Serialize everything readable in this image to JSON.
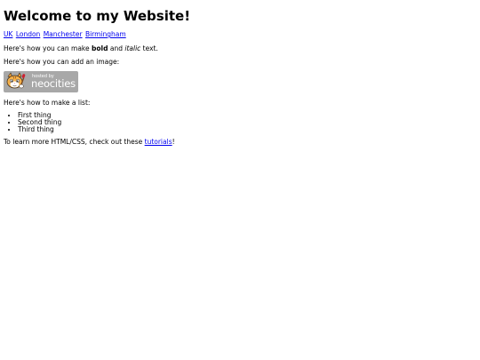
{
  "header": {
    "title": "Welcome to my Website!"
  },
  "nav": {
    "links": [
      "UK",
      "London",
      "Manchester",
      "Birmingham"
    ]
  },
  "content": {
    "bold_line": {
      "prefix": "Here's how you can make ",
      "bold": "bold",
      "middle": " and ",
      "italic": "italic",
      "suffix": " text."
    },
    "image_line": "Here's how you can add an image:",
    "badge": {
      "small_text": "hosted by",
      "brand_text": "neocities",
      "background": "#a8a8a8",
      "icon": "neocities-cat-icon"
    },
    "list_line": "Here's how to make a list:",
    "list_items": [
      "First thing",
      "Second thing",
      "Third thing"
    ],
    "learn_line": {
      "prefix": "To learn more HTML/CSS, check out these ",
      "link": "tutorials",
      "suffix": "!"
    }
  },
  "colors": {
    "link": "#0000ee",
    "text": "#000000",
    "background": "#ffffff"
  }
}
